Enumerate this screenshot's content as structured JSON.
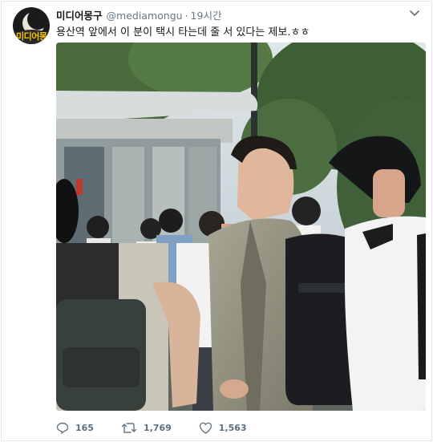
{
  "tweet": {
    "display_name": "미디어몽구",
    "handle": "@mediamongu",
    "separator": "·",
    "time": "19시간",
    "text": "용산역 앞에서 이 분이 택시 타는데 줄 서 있다는 제보.ㅎㅎ",
    "avatar_label": "미디어몽구"
  },
  "actions": {
    "reply_count": "165",
    "retweet_count": "1,769",
    "like_count": "1,563"
  },
  "colors": {
    "text": "#14171a",
    "muted": "#657786",
    "border": "#e1e8ed"
  },
  "icons": [
    "chevron-down-icon",
    "reply-icon",
    "retweet-icon",
    "heart-icon"
  ]
}
